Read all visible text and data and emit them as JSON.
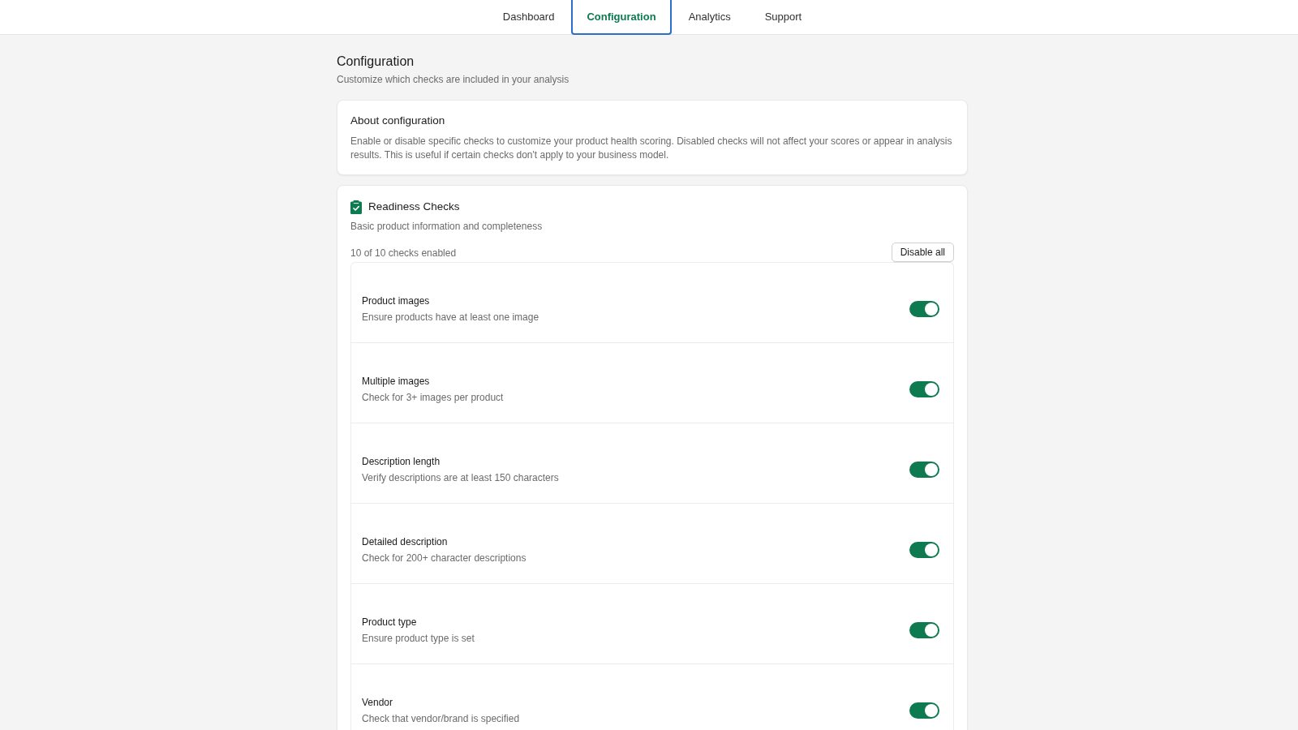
{
  "nav": {
    "tabs": [
      {
        "label": "Dashboard",
        "selected": false
      },
      {
        "label": "Configuration",
        "selected": true
      },
      {
        "label": "Analytics",
        "selected": false
      },
      {
        "label": "Support",
        "selected": false
      }
    ]
  },
  "page": {
    "title": "Configuration",
    "subtitle": "Customize which checks are included in your analysis"
  },
  "about_card": {
    "title": "About configuration",
    "text": "Enable or disable specific checks to customize your product health scoring. Disabled checks will not affect your scores or appear in analysis results. This is useful if certain checks don't apply to your business model."
  },
  "readiness_card": {
    "title": "Readiness Checks",
    "subtitle": "Basic product information and completeness",
    "count": "10 of 10 checks enabled",
    "button": "Disable all",
    "checks": [
      {
        "name": "Product images",
        "description": "Ensure products have at least one image",
        "on": true
      },
      {
        "name": "Multiple images",
        "description": "Check for 3+ images per product",
        "on": true
      },
      {
        "name": "Description length",
        "description": "Verify descriptions are at least 150 characters",
        "on": true
      },
      {
        "name": "Detailed description",
        "description": "Check for 200+ character descriptions",
        "on": true
      },
      {
        "name": "Product type",
        "description": "Ensure product type is set",
        "on": true
      },
      {
        "name": "Vendor",
        "description": "Check that vendor/brand is specified",
        "on": true
      }
    ]
  }
}
